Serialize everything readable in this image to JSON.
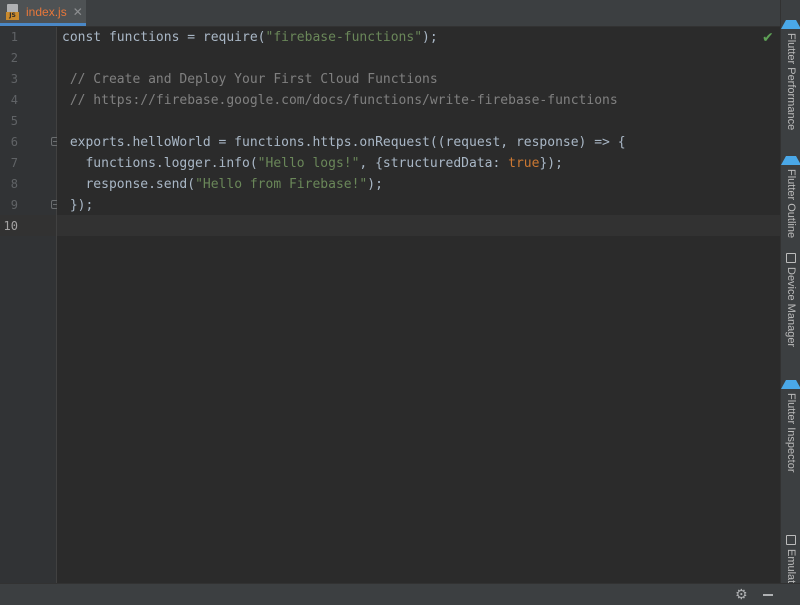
{
  "tab": {
    "label": "index.js",
    "close_glyph": "✕",
    "icon": "js-file-icon",
    "icon_badge": "JS"
  },
  "editor": {
    "current_line": 10,
    "line_numbers": [
      "1",
      "2",
      "3",
      "4",
      "5",
      "6",
      "7",
      "8",
      "9",
      "10"
    ],
    "lines": [
      {
        "n": "1",
        "segments": [
          {
            "t": "const functions = require(",
            "c": "plain"
          },
          {
            "t": "\"firebase-functions\"",
            "c": "str"
          },
          {
            "t": ");",
            "c": "plain"
          }
        ]
      },
      {
        "n": "2",
        "segments": []
      },
      {
        "n": "3",
        "segments": [
          {
            "t": " // Create and Deploy Your First Cloud Functions",
            "c": "cmt"
          }
        ]
      },
      {
        "n": "4",
        "segments": [
          {
            "t": " // https://firebase.google.com/docs/functions/write-firebase-functions",
            "c": "cmt"
          }
        ]
      },
      {
        "n": "5",
        "segments": []
      },
      {
        "n": "6",
        "segments": [
          {
            "t": " exports.helloWorld = functions.https.onRequest((request, response) => {",
            "c": "plain"
          }
        ]
      },
      {
        "n": "7",
        "segments": [
          {
            "t": "   functions.logger.info(",
            "c": "plain"
          },
          {
            "t": "\"Hello logs!\"",
            "c": "str"
          },
          {
            "t": ", {structuredData: ",
            "c": "plain"
          },
          {
            "t": "true",
            "c": "kw"
          },
          {
            "t": "});",
            "c": "plain"
          }
        ]
      },
      {
        "n": "8",
        "segments": [
          {
            "t": "   response.send(",
            "c": "plain"
          },
          {
            "t": "\"Hello from Firebase!\"",
            "c": "str"
          },
          {
            "t": ");",
            "c": "plain"
          }
        ]
      },
      {
        "n": "9",
        "segments": [
          {
            "t": " });",
            "c": "plain"
          }
        ]
      },
      {
        "n": "10",
        "segments": []
      }
    ],
    "fold_markers_on_lines": [
      6,
      9
    ],
    "status_icon": "checkmark-icon",
    "status_glyph": "✔"
  },
  "right_toolbar": [
    {
      "label": "Flutter Performance",
      "icon": "flutter-icon"
    },
    {
      "label": "Flutter Outline",
      "icon": "flutter-icon"
    },
    {
      "label": "Device Manager",
      "icon": "device-icon"
    },
    {
      "label": "Flutter Inspector",
      "icon": "flutter-icon"
    },
    {
      "label": "Emulator",
      "icon": "emulator-icon"
    }
  ],
  "status_bar": {
    "settings_icon": "gear-icon",
    "settings_glyph": "⚙",
    "minimize_icon": "minimize-icon"
  },
  "colors": {
    "background": "#2b2b2b",
    "gutter": "#313335",
    "plain": "#a9b7c6",
    "string": "#6a8759",
    "comment": "#808080",
    "keyword": "#cc7832",
    "tab_label": "#e8773a",
    "flutter": "#4aa8e8",
    "check": "#5ea156"
  }
}
